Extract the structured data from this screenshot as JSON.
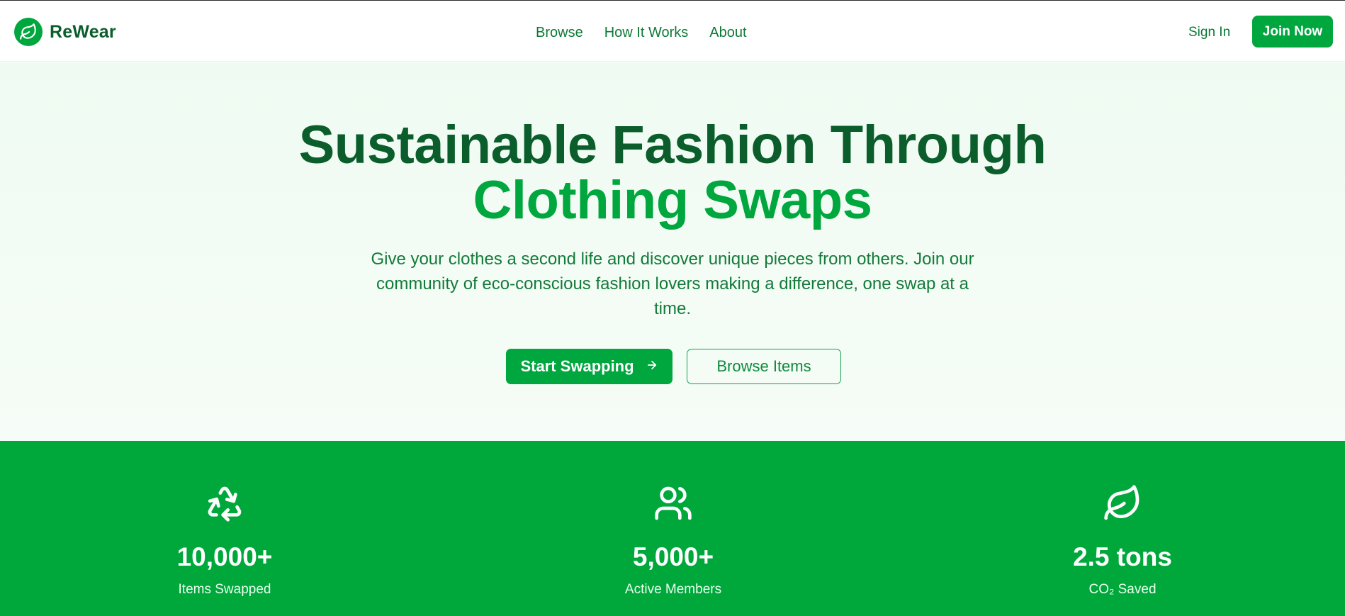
{
  "brand": {
    "name": "ReWear",
    "logo_icon": "leaf-icon",
    "colors": {
      "primary": "#00a63e",
      "dark": "#0b5d2c",
      "band": "#00a83b",
      "hero_bg": "#effbf2"
    }
  },
  "nav": {
    "items": [
      {
        "label": "Browse"
      },
      {
        "label": "How It Works"
      },
      {
        "label": "About"
      }
    ],
    "sign_in": "Sign In",
    "join": "Join Now"
  },
  "hero": {
    "title_line1": "Sustainable Fashion Through",
    "title_line2": "Clothing Swaps",
    "subtitle": "Give your clothes a second life and discover unique pieces from others. Join our community of eco-conscious fashion lovers making a difference, one swap at a time.",
    "primary_cta": "Start Swapping",
    "primary_cta_icon": "arrow-right-icon",
    "secondary_cta": "Browse Items"
  },
  "stats": [
    {
      "icon": "recycle-icon",
      "value": "10,000+",
      "label": "Items Swapped"
    },
    {
      "icon": "users-icon",
      "value": "5,000+",
      "label": "Active Members"
    },
    {
      "icon": "leaf-icon",
      "value": "2.5 tons",
      "label": "CO₂ Saved"
    }
  ]
}
